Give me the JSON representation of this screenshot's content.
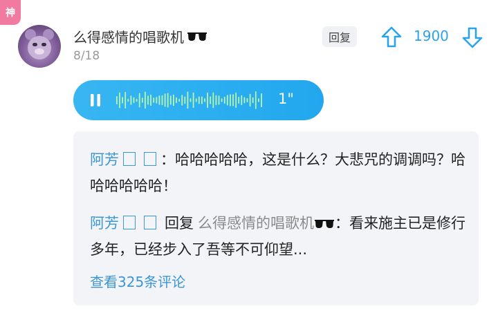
{
  "badge": {
    "label": "神"
  },
  "post": {
    "username": "么得感情的唱歌机",
    "username_suffix_icon": "sunglasses-icon",
    "date": "8/18",
    "reply_label": "回复",
    "vote_count": "1900",
    "voice": {
      "duration": "1\"",
      "state": "pause-icon"
    }
  },
  "replies": [
    {
      "author": "阿芳",
      "separator": "：",
      "text": "哈哈哈哈哈，这是什么？大悲咒的调调吗？哈哈哈哈哈哈！"
    },
    {
      "author": "阿芳",
      "reply_word": "回复",
      "target": "么得感情的唱歌机",
      "separator": "：",
      "text": "看来施主已是修行多年，已经步入了吾等不可仰望..."
    }
  ],
  "view_more": "查看325条评论",
  "colors": {
    "accent": "#2aa3ee",
    "link": "#3a96d8",
    "badge": "#f07aa0",
    "reply_bg": "#f3f4f8"
  }
}
